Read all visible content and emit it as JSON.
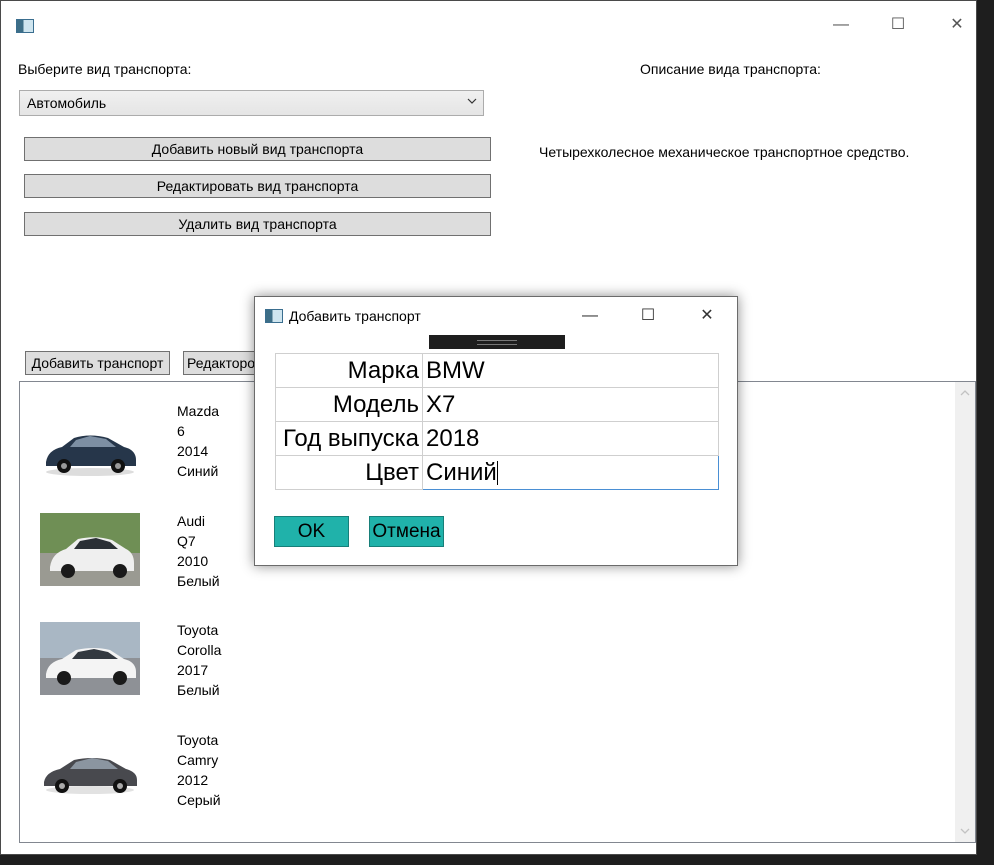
{
  "window": {
    "minimize_glyph": "—",
    "maximize_glyph": "☐",
    "close_glyph": "✕"
  },
  "main": {
    "choose_label": "Выберите вид транспорта:",
    "description_label": "Описание вида транспорта:",
    "selected_type": "Автомобиль",
    "description_text": "Четырехколесное механическое транспортное средство.",
    "buttons": {
      "add_type": "Добавить новый вид транспорта",
      "edit_type": "Редактировать вид транспорта",
      "delete_type": "Удалить вид транспорта",
      "add_transport": "Добавить транспорт",
      "edit_transport": "Редакторо"
    }
  },
  "vehicles": [
    {
      "brand": "Mazda",
      "model": "6",
      "year": "2014",
      "color": "Синий",
      "photo_color": "#2b3a4e"
    },
    {
      "brand": "Audi",
      "model": "Q7",
      "year": "2010",
      "color": "Белый",
      "photo_color": "#e8e8e8"
    },
    {
      "brand": "Toyota",
      "model": "Corolla",
      "year": "2017",
      "color": "Белый",
      "photo_color": "#f0f0f0"
    },
    {
      "brand": "Toyota",
      "model": "Camry",
      "year": "2012",
      "color": "Серый",
      "photo_color": "#4a4a4e"
    }
  ],
  "dialog": {
    "title": "Добавить транспорт",
    "fields": [
      {
        "label": "Марка",
        "value": "BMW"
      },
      {
        "label": "Модель",
        "value": "X7"
      },
      {
        "label": "Год выпуска",
        "value": "2018"
      },
      {
        "label": "Цвет",
        "value": "Синий"
      }
    ],
    "ok_label": "OK",
    "cancel_label": "Отмена",
    "accent_color": "#20b2aa"
  }
}
